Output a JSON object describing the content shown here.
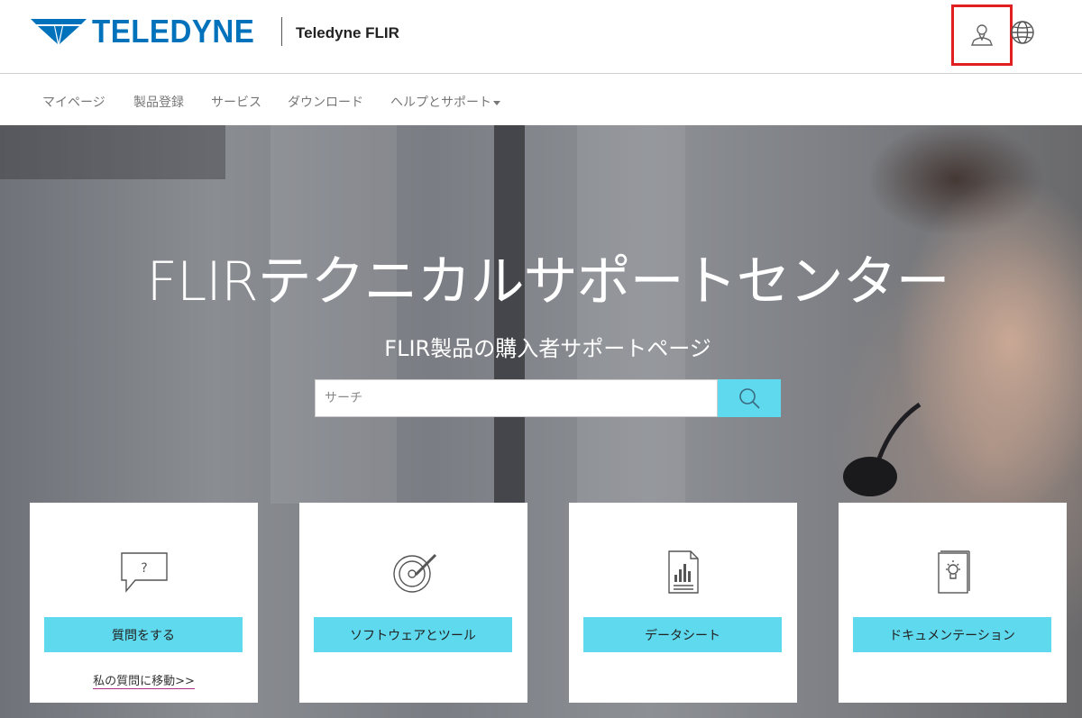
{
  "header": {
    "logo_text": "TELEDYNE",
    "brand_sub": "Teledyne FLIR",
    "user_icon": "user-icon",
    "globe_icon": "globe-icon"
  },
  "nav": {
    "items": [
      {
        "label": "マイページ"
      },
      {
        "label": "製品登録"
      },
      {
        "label": "サービス"
      },
      {
        "label": "ダウンロード"
      },
      {
        "label": "ヘルプとサポート"
      }
    ]
  },
  "hero": {
    "title": "FLIRテクニカルサポートセンター",
    "subtitle": "FLIR製品の購入者サポートページ",
    "search_placeholder": "サーチ"
  },
  "cards": [
    {
      "icon": "question-bubble-icon",
      "button_label": "質問をする",
      "link_label": "私の質問に移動>>"
    },
    {
      "icon": "software-disc-icon",
      "button_label": "ソフトウェアとツール"
    },
    {
      "icon": "datasheet-icon",
      "button_label": "データシート"
    },
    {
      "icon": "documentation-icon",
      "button_label": "ドキュメンテーション"
    }
  ],
  "colors": {
    "brand_blue": "#0072bc",
    "accent_cyan": "#5ed9ee",
    "highlight_red": "#e02020"
  }
}
